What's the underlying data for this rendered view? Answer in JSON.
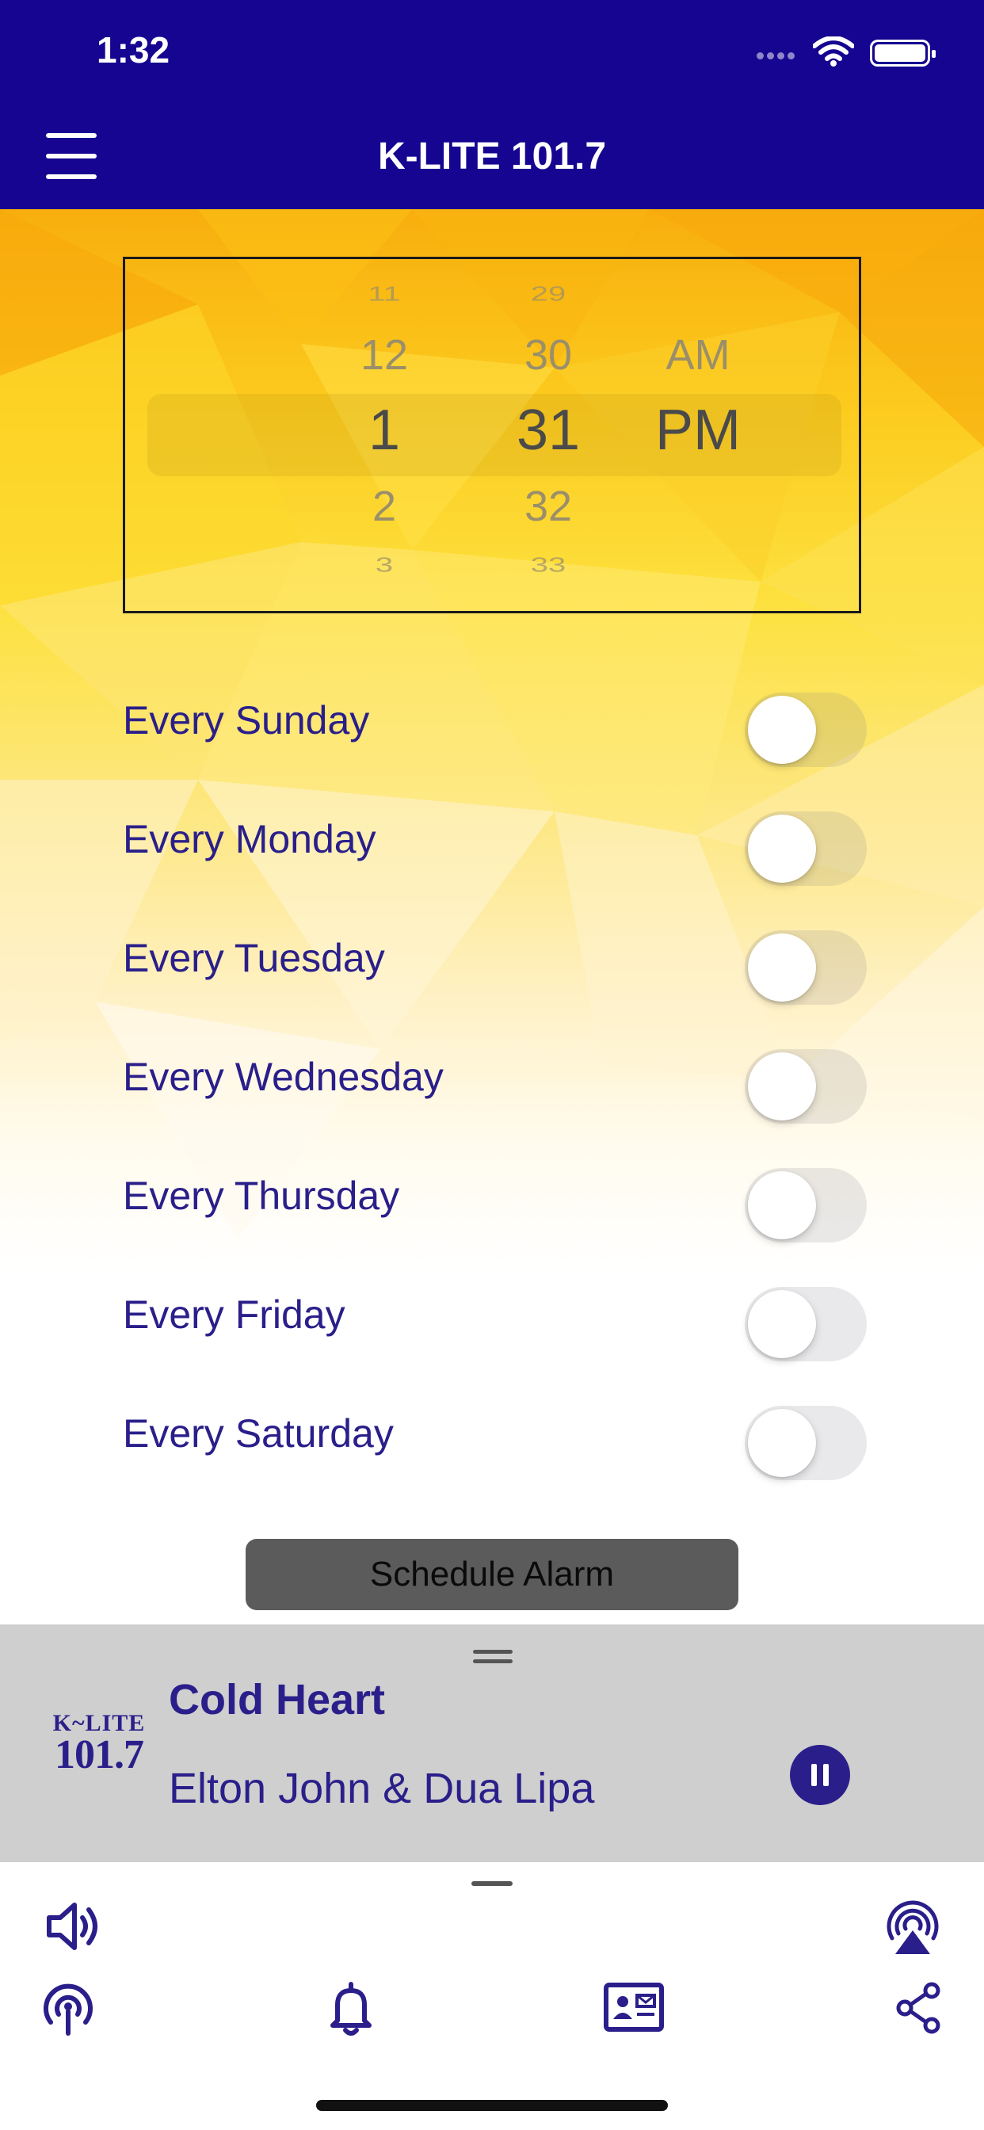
{
  "status_bar": {
    "time": "1:32"
  },
  "nav_bar": {
    "title": "K-LITE 101.7"
  },
  "time_picker": {
    "hours": [
      "11",
      "12",
      "1",
      "2",
      "3"
    ],
    "minutes": [
      "29",
      "30",
      "31",
      "32",
      "33"
    ],
    "periods": [
      "AM",
      "PM"
    ],
    "selected": {
      "hour": "1",
      "minute": "31",
      "period": "PM"
    }
  },
  "alarm_days": [
    {
      "label": "Every Sunday",
      "enabled": false
    },
    {
      "label": "Every Monday",
      "enabled": false
    },
    {
      "label": "Every Tuesday",
      "enabled": false
    },
    {
      "label": "Every Wednesday",
      "enabled": false
    },
    {
      "label": "Every Thursday",
      "enabled": false
    },
    {
      "label": "Every Friday",
      "enabled": false
    },
    {
      "label": "Every Saturday",
      "enabled": false
    }
  ],
  "schedule_button": {
    "label": "Schedule Alarm"
  },
  "now_playing": {
    "logo_top": "K~LITE",
    "logo_bottom": "101.7",
    "title": "Cold Heart",
    "artist": "Elton John & Dua Lipa",
    "state": "playing"
  },
  "toolbar": {
    "icons": [
      "volume-icon",
      "airplay-icon",
      "podcast-icon",
      "alarm-bell-icon",
      "contact-card-icon",
      "share-icon"
    ]
  },
  "colors": {
    "brand": "#150590",
    "label_text": "#2a1f8a",
    "now_playing_bg": "#cfcfcf",
    "button_bg": "#5b5b5b"
  }
}
